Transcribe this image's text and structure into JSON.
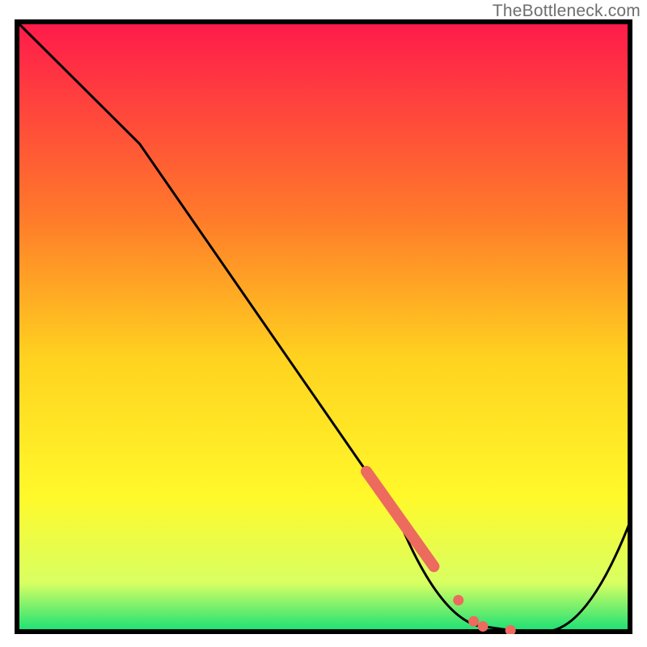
{
  "watermark": "TheBottleneck.com",
  "colors": {
    "gradient_top": "#ff1a4b",
    "gradient_mid1": "#ff7a2a",
    "gradient_mid2": "#ffd21f",
    "gradient_mid3": "#fff92b",
    "gradient_low": "#d8ff62",
    "gradient_bottom": "#17e076",
    "frame": "#000000",
    "curve": "#000000",
    "highlight": "#ed6a5e"
  },
  "chart_data": {
    "type": "line",
    "title": "",
    "xlabel": "",
    "ylabel": "",
    "xlim": [
      0,
      100
    ],
    "ylim": [
      0,
      100
    ],
    "x": [
      0,
      20,
      62,
      75,
      82,
      86,
      100
    ],
    "values": [
      100,
      80,
      19,
      1,
      0,
      0,
      18
    ],
    "highlight_segment": {
      "x_start": 57,
      "x_end": 68
    },
    "highlight_dots_x": [
      72,
      74.5,
      76,
      80.5
    ],
    "annotations": []
  }
}
